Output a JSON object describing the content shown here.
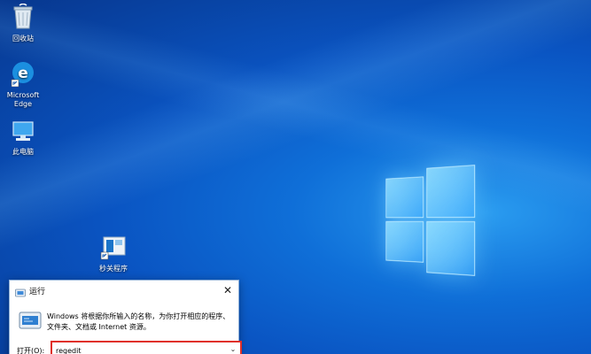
{
  "desktop": {
    "icons": [
      {
        "label": "回收站",
        "icon": "recycle-bin-icon"
      },
      {
        "label": "Microsoft Edge",
        "icon": "edge-icon"
      },
      {
        "label": "此电脑",
        "icon": "computer-icon"
      },
      {
        "label": "秒关程序",
        "icon": "shortcut-app-icon"
      }
    ],
    "accent": "#0a64d6"
  },
  "run_dialog": {
    "title": "运行",
    "close_label": "✕",
    "description": "Windows 将根据你所输入的名称，为你打开相应的程序、文件夹、文档或 Internet 资源。",
    "open_label": "打开(O):",
    "input_value": "regedit",
    "dropdown_label": "⌄",
    "highlight_color": "#e0302a"
  }
}
